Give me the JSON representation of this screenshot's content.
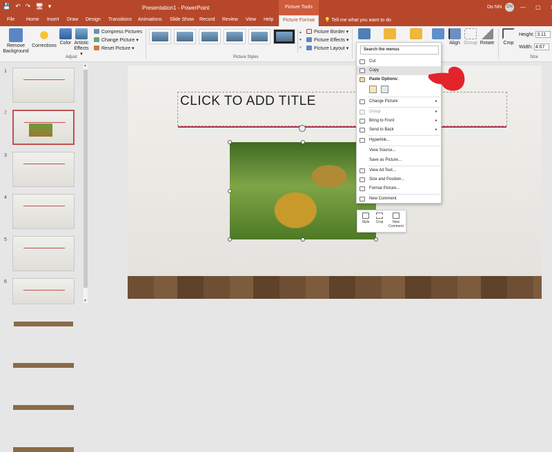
{
  "window": {
    "title": "Presentation1 - PowerPoint",
    "context_tab_group": "Picture Tools",
    "user_name": "Do Nhi",
    "user_initials": "DN",
    "qat": [
      "💾",
      "↶",
      "↷",
      "🖥",
      "▾"
    ],
    "controls": [
      "—",
      "▢",
      "✕"
    ]
  },
  "tabs": [
    "File",
    "Home",
    "Insert",
    "Draw",
    "Design",
    "Transitions",
    "Animations",
    "Slide Show",
    "Record",
    "Review",
    "View",
    "Help",
    "Picture Format"
  ],
  "active_tab": "Picture Format",
  "tell_me": "Tell me what you want to do",
  "ribbon": {
    "remove_background": [
      "Remove",
      "Background"
    ],
    "adjust": {
      "corrections": "Corrections",
      "color": "Color",
      "artistic_effects": [
        "Artistic",
        "Effects ▾"
      ],
      "compress": "Compress Pictures",
      "change": "Change Picture ▾",
      "reset": "Reset Picture ▾",
      "group_label": "Adjust"
    },
    "picture_styles": {
      "border": "Picture Border ▾",
      "effects": "Picture Effects ▾",
      "layout": "Picture Layout ▾",
      "group_label": "Picture Styles"
    },
    "arrange": {
      "align": "Align",
      "group": "Group",
      "rotate": "Rotate"
    },
    "size": {
      "crop": "Crop",
      "height_label": "Height:",
      "height_value": "3.11",
      "width_label": "Width:",
      "width_value": "4.67",
      "group_label": "Size"
    }
  },
  "slides": {
    "numbers": [
      "1",
      "2",
      "3",
      "4",
      "5",
      "6"
    ],
    "selected": "2"
  },
  "slide": {
    "title_placeholder": "CLICK TO ADD TITLE"
  },
  "context_menu": {
    "search": "Search the menus",
    "items": [
      {
        "label": "Cut",
        "icon": "scissors-icon",
        "state": "normal"
      },
      {
        "label": "Copy",
        "icon": "copy-icon",
        "state": "highlighted"
      },
      {
        "label": "Paste Options:",
        "icon": "paste-icon",
        "state": "header"
      },
      {
        "label": "Change Picture",
        "icon": "change-picture-icon",
        "state": "normal",
        "submenu": true
      },
      {
        "label": "Group",
        "icon": "group-icon",
        "state": "disabled",
        "submenu": true
      },
      {
        "label": "Bring to Front",
        "icon": "bring-front-icon",
        "state": "normal",
        "submenu": true
      },
      {
        "label": "Send to Back",
        "icon": "send-back-icon",
        "state": "normal",
        "submenu": true
      },
      {
        "label": "Hyperlink...",
        "icon": "link-icon",
        "state": "normal"
      },
      {
        "label": "View Source...",
        "icon": "",
        "state": "normal"
      },
      {
        "label": "Save as Picture...",
        "icon": "",
        "state": "normal"
      },
      {
        "label": "View Alt Text...",
        "icon": "alt-text-icon",
        "state": "normal"
      },
      {
        "label": "Size and Position...",
        "icon": "size-icon",
        "state": "normal"
      },
      {
        "label": "Format Picture...",
        "icon": "format-icon",
        "state": "normal"
      },
      {
        "label": "New Comment",
        "icon": "comment-icon",
        "state": "normal"
      }
    ]
  },
  "mini_toolbar": {
    "style": "Style",
    "crop": "Crop",
    "new_comment": [
      "New",
      "Comment"
    ]
  },
  "colors": {
    "accent": "#b7472a",
    "title_line": "#b5324a",
    "pointer": "#e3242b"
  }
}
